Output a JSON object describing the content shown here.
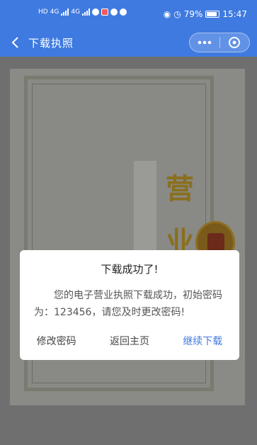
{
  "status_bar": {
    "left_labels": [
      "HD",
      "4G",
      "HD",
      "4G"
    ],
    "battery": "79%",
    "time": "15:47"
  },
  "nav": {
    "title": "下载执照",
    "back_icon": "chevron-left-icon",
    "more_icon": "more-dots-icon",
    "close_icon": "target-close-icon"
  },
  "license": {
    "big_char_1": "营",
    "big_char_2": "业"
  },
  "dialog": {
    "title": "下载成功了!",
    "message": "您的电子营业执照下载成功，初始密码为：123456，请您及时更改密码!",
    "actions": [
      "修改密码",
      "返回主页",
      "继续下载"
    ]
  },
  "colors": {
    "brand": "#3f7ae0",
    "overlay": "#6f6f6f",
    "dialog_bg": "#ffffff",
    "primary_action": "#3f7ae0"
  }
}
